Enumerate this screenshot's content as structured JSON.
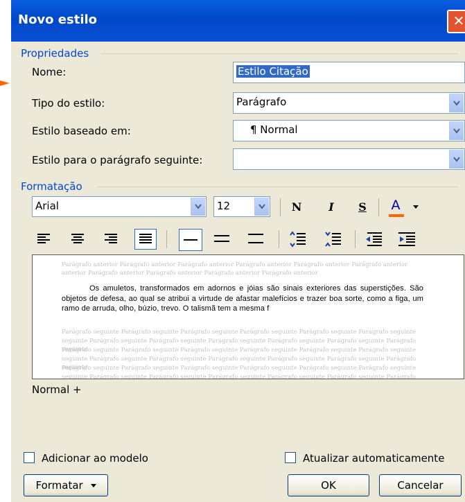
{
  "dialog": {
    "title": "Novo estilo",
    "close_glyph": "✕"
  },
  "properties": {
    "group_label": "Propriedades",
    "name_label": "Nome:",
    "name_value": "Estilo Citação",
    "type_label": "Tipo do estilo:",
    "type_value": "Parágrafo",
    "based_label": "Estilo baseado em:",
    "based_value": "¶ Normal",
    "next_label": "Estilo para o parágrafo seguinte:",
    "next_value": ""
  },
  "formatting": {
    "group_label": "Formatação",
    "font_value": "Arial",
    "size_value": "12",
    "bold_label": "N",
    "italic_label": "I",
    "strike_label": "S",
    "font_color_label": "A",
    "font_color_accent": "#ff6600"
  },
  "preview": {
    "previous_lines": [
      "Parágrafo anterior Parágrafo anterior Parágrafo anterior Parágrafo anterior Parágrafo anterior Parágrafo anterior",
      "anterior Parágrafo anterior Parágrafo anterior Parágrafo anterior Parágrafo anterior"
    ],
    "main_text": "Os amuletos, transformados em adornos e jóias são sinais exteriores das superstições. São objetos de defesa, ao qual se atribui a virtude de afastar malefícios e trazer boa sorte, como a figa, um ramo de arruda, olho, búzio, trevo. O talismã tem a mesma f",
    "following_lines": [
      "Parágrafo seguinte Parágrafo seguinte Parágrafo seguinte Parágrafo seguinte Parágrafo seguinte Parágrafo seguinte",
      "seguinte Parágrafo seguinte Parágrafo seguinte Parágrafo seguinte Parágrafo seguinte Parágrafo seguinte Parágrafo seguinte",
      "Parágrafo seguinte Parágrafo seguinte Parágrafo seguinte Parágrafo seguinte Parágrafo seguinte Parágrafo seguinte",
      "seguinte Parágrafo seguinte Parágrafo seguinte Parágrafo seguinte Parágrafo seguinte Parágrafo seguinte Parágrafo seguinte",
      "Parágrafo seguinte Parágrafo seguinte Parágrafo seguinte Parágrafo seguinte Parágrafo seguinte Parágrafo seguinte",
      "seguinte Parágrafo seguinte Parágrafo seguinte Parágrafo seguinte Parágrafo seguinte Parágrafo seguinte Parágrafo seguinte"
    ]
  },
  "description": "Normal +",
  "options": {
    "add_to_template_label": "Adicionar ao modelo",
    "auto_update_label": "Atualizar automaticamente"
  },
  "buttons": {
    "format_label": "Formatar",
    "ok_label": "OK",
    "cancel_label": "Cancelar"
  }
}
